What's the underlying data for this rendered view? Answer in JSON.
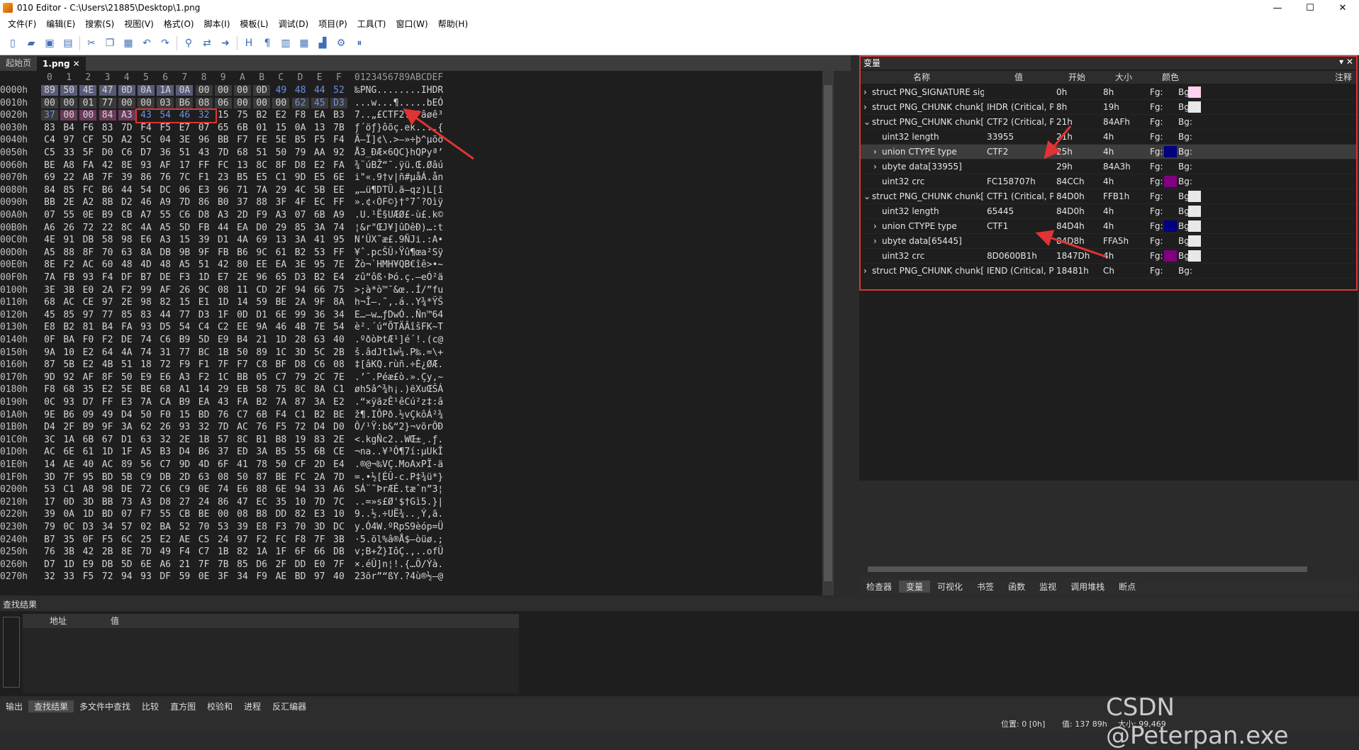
{
  "window": {
    "title": "010 Editor - C:\\Users\\21885\\Desktop\\1.png",
    "minimize": "—",
    "maximize": "☐",
    "close": "✕"
  },
  "menu": [
    "文件(F)",
    "编辑(E)",
    "搜索(S)",
    "视图(V)",
    "格式(O)",
    "脚本(I)",
    "模板(L)",
    "调试(D)",
    "项目(P)",
    "工具(T)",
    "窗口(W)",
    "帮助(H)"
  ],
  "tabs": {
    "start": "起始页",
    "file": "1.png",
    "close": "✕"
  },
  "hex": {
    "columns": [
      "0",
      "1",
      "2",
      "3",
      "4",
      "5",
      "6",
      "7",
      "8",
      "9",
      "A",
      "B",
      "C",
      "D",
      "E",
      "F"
    ],
    "ascii_header": "0123456789ABCDEF",
    "rows": [
      {
        "addr": "0000h",
        "bytes": [
          "89",
          "50",
          "4E",
          "47",
          "0D",
          "0A",
          "1A",
          "0A",
          "00",
          "00",
          "00",
          "0D",
          "49",
          "48",
          "44",
          "52"
        ],
        "ascii": "‰PNG........IHDR"
      },
      {
        "addr": "0010h",
        "bytes": [
          "00",
          "00",
          "01",
          "77",
          "00",
          "00",
          "03",
          "B6",
          "08",
          "06",
          "00",
          "00",
          "00",
          "62",
          "45",
          "D3"
        ],
        "ascii": "...w...¶.....bEÓ"
      },
      {
        "addr": "0020h",
        "bytes": [
          "37",
          "00",
          "00",
          "84",
          "A3",
          "43",
          "54",
          "46",
          "32",
          "15",
          "75",
          "B2",
          "E2",
          "F8",
          "EA",
          "B3"
        ],
        "ascii": "7..„£CTF2.u²âøê³"
      },
      {
        "addr": "0030h",
        "bytes": [
          "83",
          "B4",
          "F6",
          "83",
          "7D",
          "F4",
          "F5",
          "E7",
          "07",
          "65",
          "6B",
          "01",
          "15",
          "0A",
          "13",
          "7B"
        ],
        "ascii": "ƒ´öƒ}ôõç.ek....{"
      },
      {
        "addr": "0040h",
        "bytes": [
          "C4",
          "97",
          "CF",
          "5D",
          "A2",
          "5C",
          "04",
          "3E",
          "96",
          "BB",
          "F7",
          "FE",
          "5E",
          "B5",
          "F5",
          "F4"
        ],
        "ascii": "Ä—Ï]¢\\.>–»÷þ^µõô"
      },
      {
        "addr": "0050h",
        "bytes": [
          "C5",
          "33",
          "5F",
          "D0",
          "C6",
          "D7",
          "36",
          "51",
          "43",
          "7D",
          "68",
          "51",
          "50",
          "79",
          "AA",
          "92"
        ],
        "ascii": "Å3_ÐÆ×6QC}hQPyª’"
      },
      {
        "addr": "0060h",
        "bytes": [
          "BE",
          "A8",
          "FA",
          "42",
          "8E",
          "93",
          "AF",
          "17",
          "FF",
          "FC",
          "13",
          "8C",
          "8F",
          "D8",
          "E2",
          "FA"
        ],
        "ascii": "¾¨úBŽ“¯.ÿü.Œ.Øâú"
      },
      {
        "addr": "0070h",
        "bytes": [
          "69",
          "22",
          "AB",
          "7F",
          "39",
          "86",
          "76",
          "7C",
          "F1",
          "23",
          "B5",
          "E5",
          "C1",
          "9D",
          "E5",
          "6E"
        ],
        "ascii": "i\"«.9†v|ñ#µåÁ.ån"
      },
      {
        "addr": "0080h",
        "bytes": [
          "84",
          "85",
          "FC",
          "B6",
          "44",
          "54",
          "DC",
          "06",
          "E3",
          "96",
          "71",
          "7A",
          "29",
          "4C",
          "5B",
          "EE"
        ],
        "ascii": "„…ü¶DTÜ.ã–qz)L[î"
      },
      {
        "addr": "0090h",
        "bytes": [
          "BB",
          "2E",
          "A2",
          "8B",
          "D2",
          "46",
          "A9",
          "7D",
          "86",
          "B0",
          "37",
          "88",
          "3F",
          "4F",
          "EC",
          "FF"
        ],
        "ascii": "».¢‹ÒF©}†°7ˆ?Oìÿ"
      },
      {
        "addr": "00A0h",
        "bytes": [
          "07",
          "55",
          "0E",
          "B9",
          "CB",
          "A7",
          "55",
          "C6",
          "D8",
          "A3",
          "2D",
          "F9",
          "A3",
          "07",
          "6B",
          "A9"
        ],
        "ascii": ".U.¹Ë§UÆØ£-ù£.k©"
      },
      {
        "addr": "00B0h",
        "bytes": [
          "A6",
          "26",
          "72",
          "22",
          "8C",
          "4A",
          "A5",
          "5D",
          "FB",
          "44",
          "EA",
          "D0",
          "29",
          "85",
          "3A",
          "74"
        ],
        "ascii": "¦&r\"ŒJ¥]ûDêÐ)…:t"
      },
      {
        "addr": "00C0h",
        "bytes": [
          "4E",
          "91",
          "DB",
          "58",
          "98",
          "E6",
          "A3",
          "15",
          "39",
          "D1",
          "4A",
          "69",
          "13",
          "3A",
          "41",
          "95"
        ],
        "ascii": "N‘ÛX˜æ£.9ÑJi.:A•"
      },
      {
        "addr": "00D0h",
        "bytes": [
          "A5",
          "88",
          "8F",
          "70",
          "63",
          "8A",
          "DB",
          "9B",
          "9F",
          "FB",
          "B6",
          "9C",
          "61",
          "B2",
          "53",
          "FF"
        ],
        "ascii": "¥ˆ.pcŠÛ›Ÿû¶œa²Sÿ"
      },
      {
        "addr": "00E0h",
        "bytes": [
          "8E",
          "F2",
          "AC",
          "60",
          "48",
          "4D",
          "48",
          "A5",
          "51",
          "42",
          "80",
          "EE",
          "EA",
          "3E",
          "95",
          "7E"
        ],
        "ascii": "Žò¬`HMH¥QB€îê>•~"
      },
      {
        "addr": "00F0h",
        "bytes": [
          "7A",
          "FB",
          "93",
          "F4",
          "DF",
          "B7",
          "DE",
          "F3",
          "1D",
          "E7",
          "2E",
          "96",
          "65",
          "D3",
          "B2",
          "E4"
        ],
        "ascii": "zû“ôß·Þó.ç.–eÓ²ä"
      },
      {
        "addr": "0100h",
        "bytes": [
          "3E",
          "3B",
          "E0",
          "2A",
          "F2",
          "99",
          "AF",
          "26",
          "9C",
          "08",
          "11",
          "CD",
          "2F",
          "94",
          "66",
          "75"
        ],
        "ascii": ">;à*ò™¯&œ..Í/”fu"
      },
      {
        "addr": "0110h",
        "bytes": [
          "68",
          "AC",
          "CE",
          "97",
          "2E",
          "98",
          "82",
          "15",
          "E1",
          "1D",
          "14",
          "59",
          "BE",
          "2A",
          "9F",
          "8A"
        ],
        "ascii": "h¬Î—.˜‚.á..Y¾*ŸŠ"
      },
      {
        "addr": "0120h",
        "bytes": [
          "45",
          "85",
          "97",
          "77",
          "85",
          "83",
          "44",
          "77",
          "D3",
          "1F",
          "0D",
          "D1",
          "6E",
          "99",
          "36",
          "34"
        ],
        "ascii": "E…—w…ƒDwÓ..Ñn™64"
      },
      {
        "addr": "0130h",
        "bytes": [
          "E8",
          "B2",
          "81",
          "B4",
          "FA",
          "93",
          "D5",
          "54",
          "C4",
          "C2",
          "EE",
          "9A",
          "46",
          "4B",
          "7E",
          "54"
        ],
        "ascii": "è².´ú“ÕTÄÂîšFK~T"
      },
      {
        "addr": "0140h",
        "bytes": [
          "0F",
          "BA",
          "F0",
          "F2",
          "DE",
          "74",
          "C6",
          "B9",
          "5D",
          "E9",
          "B4",
          "21",
          "1D",
          "28",
          "63",
          "40"
        ],
        "ascii": ".ºðòÞtÆ¹]é´!.(c@"
      },
      {
        "addr": "0150h",
        "bytes": [
          "9A",
          "10",
          "E2",
          "64",
          "4A",
          "74",
          "31",
          "77",
          "BC",
          "1B",
          "50",
          "89",
          "1C",
          "3D",
          "5C",
          "2B"
        ],
        "ascii": "š.âdJt1w¼.P‰.=\\+"
      },
      {
        "addr": "0160h",
        "bytes": [
          "87",
          "5B",
          "E2",
          "4B",
          "51",
          "18",
          "72",
          "F9",
          "F1",
          "7F",
          "F7",
          "C8",
          "BF",
          "D8",
          "C6",
          "08"
        ],
        "ascii": "‡[âKQ.rùñ.÷È¿ØÆ."
      },
      {
        "addr": "0170h",
        "bytes": [
          "9D",
          "92",
          "AF",
          "8F",
          "50",
          "E9",
          "E6",
          "A3",
          "F2",
          "1C",
          "BB",
          "05",
          "C7",
          "79",
          "2C",
          "7E"
        ],
        "ascii": ".’¯.Péæ£ò.».Çy,~"
      },
      {
        "addr": "0180h",
        "bytes": [
          "F8",
          "68",
          "35",
          "E2",
          "5E",
          "BE",
          "68",
          "A1",
          "14",
          "29",
          "EB",
          "58",
          "75",
          "8C",
          "8A",
          "C1"
        ],
        "ascii": "øh5â^¾h¡.)ëXuŒŠÁ"
      },
      {
        "addr": "0190h",
        "bytes": [
          "0C",
          "93",
          "D7",
          "FF",
          "E3",
          "7A",
          "CA",
          "B9",
          "EA",
          "43",
          "FA",
          "B2",
          "7A",
          "87",
          "3A",
          "E2"
        ],
        "ascii": ".“×ÿãzÊ¹êCú²z‡:â"
      },
      {
        "addr": "01A0h",
        "bytes": [
          "9E",
          "B6",
          "09",
          "49",
          "D4",
          "50",
          "F0",
          "15",
          "BD",
          "76",
          "C7",
          "6B",
          "F4",
          "C1",
          "B2",
          "BE"
        ],
        "ascii": "ž¶.IÔPð.½vÇkôÁ²¾"
      },
      {
        "addr": "01B0h",
        "bytes": [
          "D4",
          "2F",
          "B9",
          "9F",
          "3A",
          "62",
          "26",
          "93",
          "32",
          "7D",
          "AC",
          "76",
          "F5",
          "72",
          "D4",
          "D0"
        ],
        "ascii": "Ô/¹Ÿ:b&“2}¬võrÔÐ"
      },
      {
        "addr": "01C0h",
        "bytes": [
          "3C",
          "1A",
          "6B",
          "67",
          "D1",
          "63",
          "32",
          "2E",
          "1B",
          "57",
          "8C",
          "B1",
          "B8",
          "19",
          "83",
          "2E"
        ],
        "ascii": "<.kgÑc2..WŒ±¸.ƒ."
      },
      {
        "addr": "01D0h",
        "bytes": [
          "AC",
          "6E",
          "61",
          "1D",
          "1F",
          "A5",
          "B3",
          "D4",
          "B6",
          "37",
          "ED",
          "3A",
          "B5",
          "55",
          "6B",
          "CE"
        ],
        "ascii": "¬na..¥³Ô¶7í:µUkÎ"
      },
      {
        "addr": "01E0h",
        "bytes": [
          "14",
          "AE",
          "40",
          "AC",
          "89",
          "56",
          "C7",
          "9D",
          "4D",
          "6F",
          "41",
          "78",
          "50",
          "CF",
          "2D",
          "E4"
        ],
        "ascii": ".®@¬‰VÇ.MoAxPÏ-ä"
      },
      {
        "addr": "01F0h",
        "bytes": [
          "3D",
          "7F",
          "95",
          "BD",
          "5B",
          "C9",
          "DB",
          "2D",
          "63",
          "08",
          "50",
          "87",
          "BE",
          "FC",
          "2A",
          "7D"
        ],
        "ascii": "=.•½[ÉÛ-c.P‡¾ü*}"
      },
      {
        "addr": "0200h",
        "bytes": [
          "53",
          "C1",
          "A8",
          "98",
          "DE",
          "72",
          "C6",
          "C9",
          "0E",
          "74",
          "E6",
          "88",
          "6E",
          "94",
          "33",
          "A6"
        ],
        "ascii": "SÁ¨˜ÞrÆÉ.tæˆn”3¦"
      },
      {
        "addr": "0210h",
        "bytes": [
          "17",
          "0D",
          "3D",
          "BB",
          "73",
          "A3",
          "D8",
          "27",
          "24",
          "86",
          "47",
          "EC",
          "35",
          "10",
          "7D",
          "7C"
        ],
        "ascii": "..=»s£Ø'$†Gì5.}|"
      },
      {
        "addr": "0220h",
        "bytes": [
          "39",
          "0A",
          "1D",
          "BD",
          "07",
          "F7",
          "55",
          "CB",
          "BE",
          "00",
          "08",
          "B8",
          "DD",
          "82",
          "E3",
          "10"
        ],
        "ascii": "9..½.÷UË¾..¸Ý‚ã."
      },
      {
        "addr": "0230h",
        "bytes": [
          "79",
          "0C",
          "D3",
          "34",
          "57",
          "02",
          "BA",
          "52",
          "70",
          "53",
          "39",
          "E8",
          "F3",
          "70",
          "3D",
          "DC"
        ],
        "ascii": "y.Ó4W.ºRpS9èóp=Ü"
      },
      {
        "addr": "0240h",
        "bytes": [
          "B7",
          "35",
          "0F",
          "F5",
          "6C",
          "25",
          "E2",
          "AE",
          "C5",
          "24",
          "97",
          "F2",
          "FC",
          "F8",
          "7F",
          "3B"
        ],
        "ascii": "·5.õl%â®Å$—òüø.;"
      },
      {
        "addr": "0250h",
        "bytes": [
          "76",
          "3B",
          "42",
          "2B",
          "8E",
          "7D",
          "49",
          "F4",
          "C7",
          "1B",
          "82",
          "1A",
          "1F",
          "6F",
          "66",
          "DB"
        ],
        "ascii": "v;B+Ž}IôÇ.‚..ofÛ"
      },
      {
        "addr": "0260h",
        "bytes": [
          "D7",
          "1D",
          "E9",
          "DB",
          "5D",
          "6E",
          "A6",
          "21",
          "7F",
          "7B",
          "85",
          "D6",
          "2F",
          "DD",
          "E0",
          "7F"
        ],
        "ascii": "×.éÛ]n¦!.{…Ö/Ýà."
      },
      {
        "addr": "0270h",
        "bytes": [
          "32",
          "33",
          "F5",
          "72",
          "94",
          "93",
          "DF",
          "59",
          "0E",
          "3F",
          "34",
          "F9",
          "AE",
          "BD",
          "97",
          "40"
        ],
        "ascii": "23õr”“ßY.?4ù®½—@"
      }
    ]
  },
  "variables": {
    "panel_title": "变量",
    "columns": {
      "name": "名称",
      "value": "值",
      "start": "开始",
      "size": "大小",
      "color": "颜色",
      "comment": "注释"
    },
    "rows": [
      {
        "indent": 0,
        "arrow": "›",
        "name": "struct PNG_SIGNATURE sig",
        "value": "",
        "start": "0h",
        "size": "8h",
        "fg": "Fg:",
        "bg": "Bg:",
        "bgcolor": "#ffd0f0",
        "fgcolor": ""
      },
      {
        "indent": 0,
        "arrow": "›",
        "name": "struct PNG_CHUNK chunk[0]",
        "value": "IHDR  (Critical, Pu...",
        "start": "8h",
        "size": "19h",
        "fg": "Fg:",
        "bg": "Bg:",
        "bgcolor": "#e8e8e8",
        "fgcolor": ""
      },
      {
        "indent": 0,
        "arrow": "⌄",
        "name": "struct PNG_CHUNK chunk[1]",
        "value": "CTF2  (Critical, Pu...",
        "start": "21h",
        "size": "84AFh",
        "fg": "Fg:",
        "bg": "Bg:",
        "bgcolor": "",
        "fgcolor": ""
      },
      {
        "indent": 1,
        "arrow": "",
        "name": "uint32 length",
        "value": "33955",
        "start": "21h",
        "size": "4h",
        "fg": "Fg:",
        "bg": "Bg:",
        "bgcolor": "",
        "fgcolor": ""
      },
      {
        "indent": 1,
        "arrow": "›",
        "name": "union CTYPE type",
        "value": "CTF2",
        "start": "25h",
        "size": "4h",
        "fg": "Fg:",
        "bg": "Bg:",
        "bgcolor": "",
        "fgcolor": "#000080",
        "selected": true
      },
      {
        "indent": 1,
        "arrow": "›",
        "name": "ubyte data[33955]",
        "value": "",
        "start": "29h",
        "size": "84A3h",
        "fg": "Fg:",
        "bg": "Bg:",
        "bgcolor": "",
        "fgcolor": ""
      },
      {
        "indent": 1,
        "arrow": "",
        "name": "uint32 crc",
        "value": "FC158707h",
        "start": "84CCh",
        "size": "4h",
        "fg": "Fg:",
        "bg": "Bg:",
        "bgcolor": "",
        "fgcolor": "#800080"
      },
      {
        "indent": 0,
        "arrow": "⌄",
        "name": "struct PNG_CHUNK chunk[2]",
        "value": "CTF1  (Critical, Pu...",
        "start": "84D0h",
        "size": "FFB1h",
        "fg": "Fg:",
        "bg": "Bg:",
        "bgcolor": "#e8e8e8",
        "fgcolor": ""
      },
      {
        "indent": 1,
        "arrow": "",
        "name": "uint32 length",
        "value": "65445",
        "start": "84D0h",
        "size": "4h",
        "fg": "Fg:",
        "bg": "Bg:",
        "bgcolor": "#e8e8e8",
        "fgcolor": ""
      },
      {
        "indent": 1,
        "arrow": "›",
        "name": "union CTYPE type",
        "value": "CTF1",
        "start": "84D4h",
        "size": "4h",
        "fg": "Fg:",
        "bg": "Bg:",
        "bgcolor": "#e8e8e8",
        "fgcolor": "#000080"
      },
      {
        "indent": 1,
        "arrow": "›",
        "name": "ubyte data[65445]",
        "value": "",
        "start": "84D8h",
        "size": "FFA5h",
        "fg": "Fg:",
        "bg": "Bg:",
        "bgcolor": "#e8e8e8",
        "fgcolor": ""
      },
      {
        "indent": 1,
        "arrow": "",
        "name": "uint32 crc",
        "value": "8D0600B1h",
        "start": "1847Dh",
        "size": "4h",
        "fg": "Fg:",
        "bg": "Bg:",
        "bgcolor": "#e8e8e8",
        "fgcolor": "#800080"
      },
      {
        "indent": 0,
        "arrow": "›",
        "name": "struct PNG_CHUNK chunk[3]",
        "value": "IEND  (Critical, Pu...",
        "start": "18481h",
        "size": "Ch",
        "fg": "Fg:",
        "bg": "Bg:",
        "bgcolor": "",
        "fgcolor": ""
      }
    ]
  },
  "bottom_tabs": [
    "检查器",
    "变量",
    "可视化",
    "书签",
    "函数",
    "监视",
    "调用堆栈",
    "断点"
  ],
  "find": {
    "title": "查找结果",
    "col_address": "地址",
    "col_value": "值"
  },
  "status_tabs": [
    "输出",
    "查找结果",
    "多文件中查找",
    "比较",
    "直方图",
    "校验和",
    "进程",
    "反汇编器"
  ],
  "status": {
    "position": "位置: 0 [0h]",
    "value": "值: 137 89h",
    "size": "大小: 99,469"
  },
  "watermark": "CSDN @Peterpan.exe",
  "colors": {
    "accent_red": "#e03333",
    "bg_dark": "#1e1e1e",
    "panel": "#2d2d2d"
  }
}
